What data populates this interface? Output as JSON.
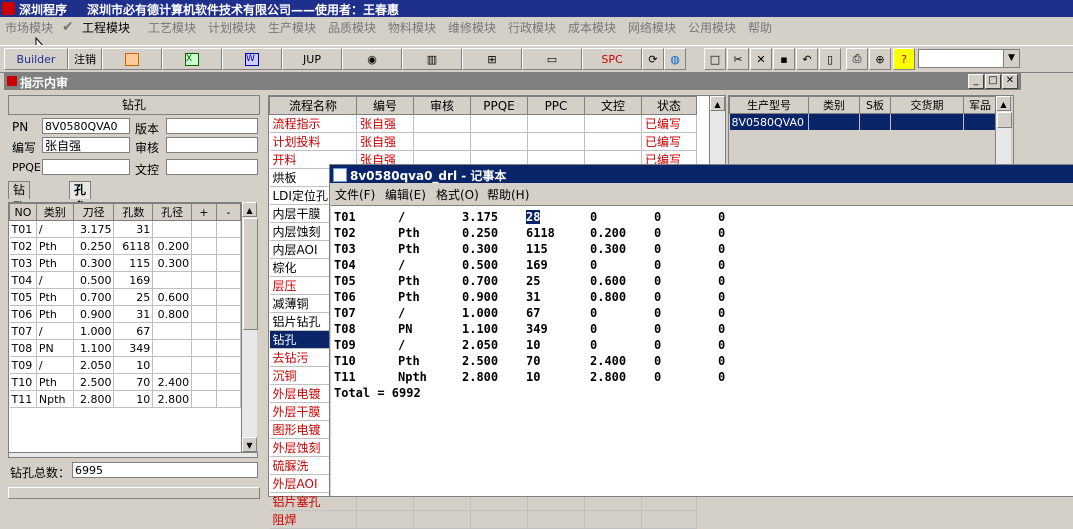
{
  "titlebar": {
    "app": "深圳程序",
    "company": "深圳市必有德计算机软件技术有限公司——使用者：王春惠"
  },
  "menu": [
    "市场模块",
    "工程模块",
    "工艺模块",
    "计划模块",
    "生产模块",
    "品质模块",
    "物料模块",
    "维修模块",
    "行政模块",
    "成本模块",
    "网络模块",
    "公用模块",
    "帮助"
  ],
  "toolbar": {
    "builder": "Builder",
    "logout": "注销",
    "jup": "JUP",
    "spc": "SPC"
  },
  "mdi": {
    "title": "指示内审"
  },
  "left": {
    "header": "钻孔",
    "pn_label": "PN",
    "pn_value": "8V0580QVA0",
    "version_label": "版本",
    "author_label": "编写",
    "author_value": "张自强",
    "review_label": "审核",
    "ppqe_label": "PPQE",
    "doc_label": "文控",
    "tab1": "钻孔要求",
    "tab2": "孔参数表",
    "grid_headers": [
      "NO",
      "类别",
      "刀径",
      "孔数",
      "孔径",
      "+",
      "-"
    ],
    "grid_rows": [
      [
        "T01",
        "/",
        "3.175",
        "31",
        ""
      ],
      [
        "T02",
        "Pth",
        "0.250",
        "6118",
        "0.200"
      ],
      [
        "T03",
        "Pth",
        "0.300",
        "115",
        "0.300"
      ],
      [
        "T04",
        "/",
        "0.500",
        "169",
        ""
      ],
      [
        "T05",
        "Pth",
        "0.700",
        "25",
        "0.600"
      ],
      [
        "T06",
        "Pth",
        "0.900",
        "31",
        "0.800"
      ],
      [
        "T07",
        "/",
        "1.000",
        "67",
        ""
      ],
      [
        "T08",
        "PN",
        "1.100",
        "349",
        ""
      ],
      [
        "T09",
        "/",
        "2.050",
        "10",
        ""
      ],
      [
        "T10",
        "Pth",
        "2.500",
        "70",
        "2.400"
      ],
      [
        "T11",
        "Npth",
        "2.800",
        "10",
        "2.800"
      ]
    ],
    "total_label": "钻孔总数：",
    "total_value": "6995"
  },
  "mid": {
    "headers": [
      "流程名称",
      "编号",
      "审核",
      "PPQE",
      "PPC",
      "文控",
      "状态"
    ],
    "rows": [
      {
        "name": "流程指示",
        "author": "张自强",
        "status": "已编写",
        "red": true
      },
      {
        "name": "计划投料",
        "author": "张自强",
        "status": "已编写",
        "red": true
      },
      {
        "name": "开料",
        "author": "张自强",
        "status": "已编写",
        "red": true
      },
      {
        "name": "烘板",
        "red": false
      },
      {
        "name": "LDI定位孔",
        "red": false
      },
      {
        "name": "内层干膜",
        "red": false
      },
      {
        "name": "内层蚀刻",
        "red": false
      },
      {
        "name": "内层AOI",
        "red": false
      },
      {
        "name": "棕化",
        "red": false
      },
      {
        "name": "层压",
        "red": true
      },
      {
        "name": "减薄铜",
        "red": false
      },
      {
        "name": "铝片钻孔",
        "red": false
      },
      {
        "name": "钻孔",
        "red": false,
        "sel": true
      },
      {
        "name": "去钻污",
        "red": true
      },
      {
        "name": "沉铜",
        "red": true
      },
      {
        "name": "外层电镀",
        "red": true
      },
      {
        "name": "外层干膜",
        "red": true
      },
      {
        "name": "图形电镀",
        "red": true
      },
      {
        "name": "外层蚀刻",
        "red": true
      },
      {
        "name": "硫脲洗",
        "red": true
      },
      {
        "name": "外层AOI",
        "red": true
      },
      {
        "name": "铝片塞孔",
        "red": true
      },
      {
        "name": "阻焊",
        "red": true
      }
    ]
  },
  "right": {
    "headers": [
      "生产型号",
      "类别",
      "S板",
      "交货期",
      "军品"
    ],
    "row": "8V0580QVA0"
  },
  "notepad": {
    "title": "8v0580qva0_drl - 记事本",
    "menu": [
      "文件(F)",
      "编辑(E)",
      "格式(O)",
      "帮助(H)"
    ],
    "lines": [
      [
        "T01",
        "/",
        "3.175",
        "28",
        "0",
        "0",
        "0"
      ],
      [
        "T02",
        "Pth",
        "0.250",
        "6118",
        "0.200",
        "0",
        "0"
      ],
      [
        "T03",
        "Pth",
        "0.300",
        "115",
        "0.300",
        "0",
        "0"
      ],
      [
        "T04",
        "/",
        "0.500",
        "169",
        "0",
        "0",
        "0"
      ],
      [
        "T05",
        "Pth",
        "0.700",
        "25",
        "0.600",
        "0",
        "0"
      ],
      [
        "T06",
        "Pth",
        "0.900",
        "31",
        "0.800",
        "0",
        "0"
      ],
      [
        "T07",
        "/",
        "1.000",
        "67",
        "0",
        "0",
        "0"
      ],
      [
        "T08",
        "PN",
        "1.100",
        "349",
        "0",
        "0",
        "0"
      ],
      [
        "T09",
        "/",
        "2.050",
        "10",
        "0",
        "0",
        "0"
      ],
      [
        "T10",
        "Pth",
        "2.500",
        "70",
        "2.400",
        "0",
        "0"
      ],
      [
        "T11",
        "Npth",
        "2.800",
        "10",
        "2.800",
        "0",
        "0"
      ]
    ],
    "total": "Total = 6992"
  }
}
